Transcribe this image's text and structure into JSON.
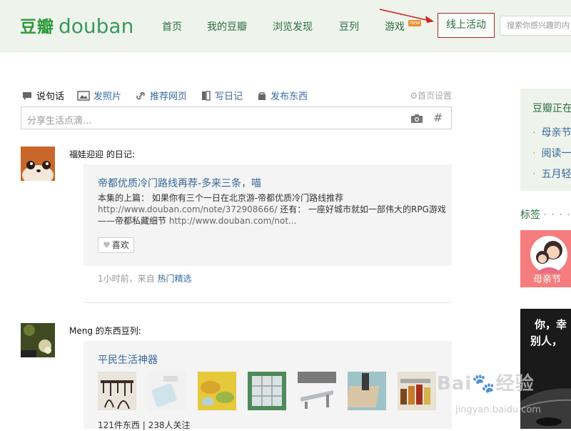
{
  "header": {
    "logo_cn": "豆瓣",
    "logo_en": "douban",
    "nav": [
      {
        "label": "首页"
      },
      {
        "label": "我的豆瓣"
      },
      {
        "label": "浏览发现"
      },
      {
        "label": "豆列"
      },
      {
        "label": "游戏",
        "badge": "new"
      }
    ],
    "online_activity": "线上活动",
    "search_placeholder": "搜索你感兴趣的内"
  },
  "composer": {
    "actions": [
      {
        "label": "说句话",
        "icon": "speech-bubble-icon"
      },
      {
        "label": "发照片",
        "icon": "photo-icon"
      },
      {
        "label": "推荐网页",
        "icon": "link-icon"
      },
      {
        "label": "写日记",
        "icon": "book-icon"
      },
      {
        "label": "发布东西",
        "icon": "bag-icon"
      }
    ],
    "home_settings": "首页设置",
    "placeholder": "分享生活点滴..."
  },
  "feed": [
    {
      "author_line": "福娃迎迎 的日记:",
      "title": "帝都优质冷门路线再荐-多来三条，喵",
      "body_1": "本集的上篇：  如果你有三个一日在北京游-帝都优质冷门路线推荐",
      "body_2_url": "http://www.douban.com/note/372908666/",
      "body_2_rest": " 还有：  一座好城市就如一部伟大的RPG游戏",
      "body_3_text": "——帝都私藏细节 ",
      "body_3_url": "http://www.douban.com/not...",
      "like": "喜欢",
      "time": "1小时前，来自 ",
      "source": "热门精选"
    },
    {
      "author_line": "Meng 的东西豆列:",
      "title": "平民生活神器",
      "stats": "121件东西 | 238人关注"
    }
  ],
  "sidebar": {
    "box_title": "豆瓣正在",
    "items": [
      "母亲节",
      "阅读一",
      "五月轻"
    ],
    "tags_label": "标签",
    "tags_dots": "· · · · ·",
    "promo1_label": "母亲节",
    "promo2_line1": "你，幸",
    "promo2_line2": "别人，"
  },
  "watermark": {
    "main": "Bai🐾经验",
    "sub": "jingyan.baidu.com"
  },
  "colors": {
    "brand_green": "#2d9a3a",
    "nav_green": "#2b6e3f",
    "link_blue": "#37689b",
    "topbar_bg": "#eef3ec",
    "highlight_red": "#a52a2a"
  }
}
